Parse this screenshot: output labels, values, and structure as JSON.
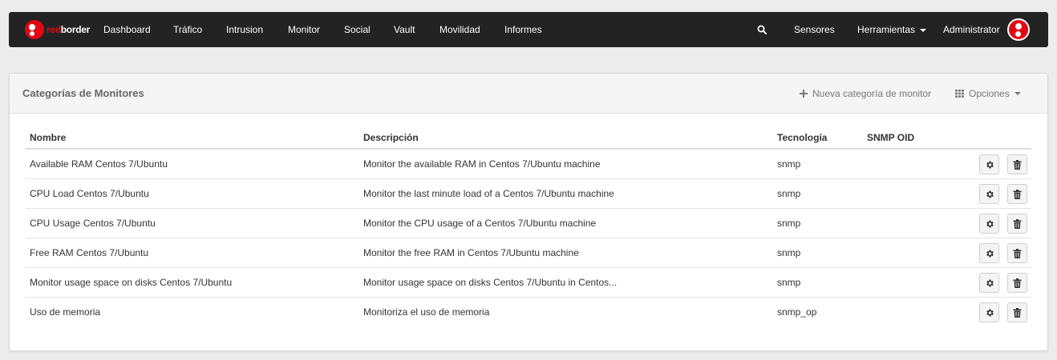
{
  "brand": {
    "part1": "red",
    "part2": "border",
    "logo_icon": "redborder-logo-icon"
  },
  "nav": {
    "items": [
      "Dashboard",
      "Tráfico",
      "Intrusion",
      "Monitor",
      "Social",
      "Vault",
      "Movilidad",
      "Informes"
    ],
    "search_icon": "search-icon",
    "sensores": "Sensores",
    "herramientas": "Herramientas",
    "user": "Administrator",
    "avatar_icon": "avatar-icon"
  },
  "panel": {
    "title": "Categorías de Monitores",
    "new_label": "Nueva categoría de monitor",
    "options_label": "Opciones",
    "new_icon": "plus-icon",
    "options_icon": "grid-icon"
  },
  "table": {
    "headers": {
      "name": "Nombre",
      "description": "Descripción",
      "technology": "Tecnología",
      "snmp_oid": "SNMP OID"
    },
    "rows": [
      {
        "name": "Available RAM Centos 7/Ubuntu",
        "description": "Monitor the available RAM in Centos 7/Ubuntu machine",
        "technology": "snmp",
        "snmp_oid": ""
      },
      {
        "name": "CPU Load Centos 7/Ubuntu",
        "description": "Monitor the last minute load of a Centos 7/Ubuntu machine",
        "technology": "snmp",
        "snmp_oid": ""
      },
      {
        "name": "CPU Usage Centos 7/Ubuntu",
        "description": "Monitor the CPU usage of a Centos 7/Ubuntu machine",
        "technology": "snmp",
        "snmp_oid": ""
      },
      {
        "name": "Free RAM Centos 7/Ubuntu",
        "description": "Monitor the free RAM in Centos 7/Ubuntu machine",
        "technology": "snmp",
        "snmp_oid": ""
      },
      {
        "name": "Monitor usage space on disks Centos 7/Ubuntu",
        "description": "Monitor usage space on disks Centos 7/Ubuntu in Centos...",
        "technology": "snmp",
        "snmp_oid": ""
      },
      {
        "name": "Uso de memoria",
        "description": "Monitoriza el uso de memoria",
        "technology": "snmp_op",
        "snmp_oid": ""
      }
    ],
    "row_actions": [
      "gear-icon",
      "trash-icon"
    ]
  },
  "colors": {
    "navbar": "#232323",
    "brand_red": "#e30613",
    "background": "#ececec"
  }
}
